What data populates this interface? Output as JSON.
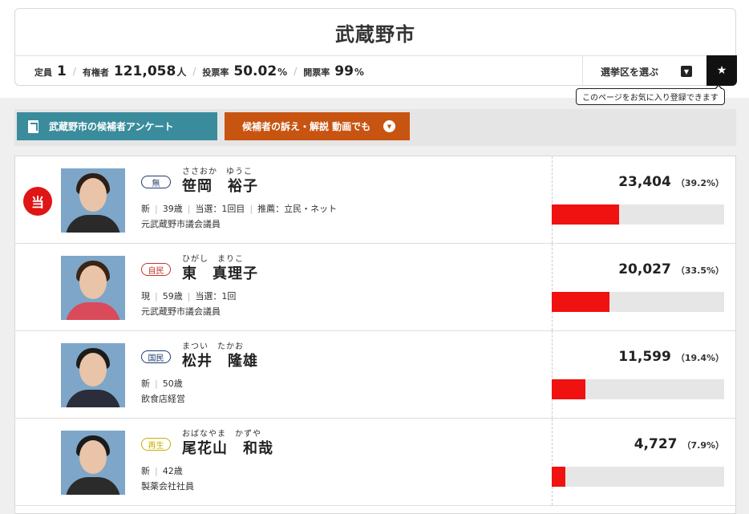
{
  "header": {
    "city": "武蔵野市",
    "stats": [
      {
        "label": "定員",
        "value": "1",
        "unit": ""
      },
      {
        "label": "有権者",
        "value": "121,058",
        "unit": "人"
      },
      {
        "label": "投票率",
        "value": "50.02",
        "unit": "%"
      },
      {
        "label": "開票率",
        "value": "99",
        "unit": "%"
      }
    ],
    "district_select_label": "選挙区を選ぶ",
    "favorite_tooltip": "このページをお気に入り登録できます"
  },
  "buttons": {
    "survey": "武蔵野市の候補者アンケート",
    "video": "候補者の訴え・解説 動画でも"
  },
  "elected_mark": "当",
  "candidates": [
    {
      "elected": true,
      "party": "無",
      "party_color": "#1f3c6e",
      "kana": "ささおか　ゆうこ",
      "name": "笹岡　裕子",
      "status": "新",
      "age": "39歳",
      "wins": "当選：1回目",
      "endorsement": "推薦：立民・ネット",
      "career": "元武蔵野市議会議員",
      "votes": "23,404",
      "percent": "（39.2%）",
      "share": 0.392,
      "photo_hair": "#2d1f18",
      "photo_body": "#2a2a2a",
      "photo_bg": "#7ea6c9"
    },
    {
      "elected": false,
      "party": "自民",
      "party_color": "#c0392b",
      "kana": "ひがし　まりこ",
      "name": "東　真理子",
      "status": "現",
      "age": "59歳",
      "wins": "当選：1回",
      "endorsement": "",
      "career": "元武蔵野市議会議員",
      "votes": "20,027",
      "percent": "（33.5%）",
      "share": 0.335,
      "photo_hair": "#3a2416",
      "photo_body": "#d94b5a",
      "photo_bg": "#7ea6c9"
    },
    {
      "elected": false,
      "party": "国民",
      "party_color": "#1f3c6e",
      "kana": "まつい　たかお",
      "name": "松井　隆雄",
      "status": "新",
      "age": "50歳",
      "wins": "",
      "endorsement": "",
      "career": "飲食店経営",
      "votes": "11,599",
      "percent": "（19.4%）",
      "share": 0.194,
      "photo_hair": "#1b1b1b",
      "photo_body": "#2b2d3a",
      "photo_bg": "#7ea6c9"
    },
    {
      "elected": false,
      "party": "再生",
      "party_color": "#c9b000",
      "kana": "おばなやま　かずや",
      "name": "尾花山　和哉",
      "status": "新",
      "age": "42歳",
      "wins": "",
      "endorsement": "",
      "career": "製薬会社社員",
      "votes": "4,727",
      "percent": "（7.9%）",
      "share": 0.079,
      "photo_hair": "#1b1b1b",
      "photo_body": "#2b2b2b",
      "photo_bg": "#7ea6c9"
    }
  ]
}
